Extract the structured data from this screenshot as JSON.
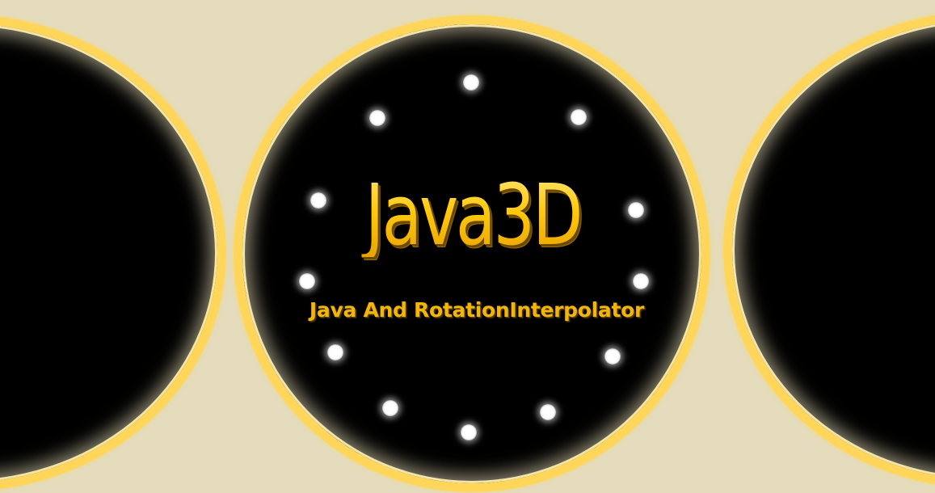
{
  "banner": {
    "title": "Java3D",
    "subtitle": "Java And RotationInterpolator"
  },
  "colors": {
    "background": "#e4dcbc",
    "disc_fill": "#000000",
    "disc_ring": "#ffd65a",
    "title_gold": "#ffc90e",
    "subtitle_gold": "#f2b50c",
    "light_dots": "#ffffff"
  }
}
